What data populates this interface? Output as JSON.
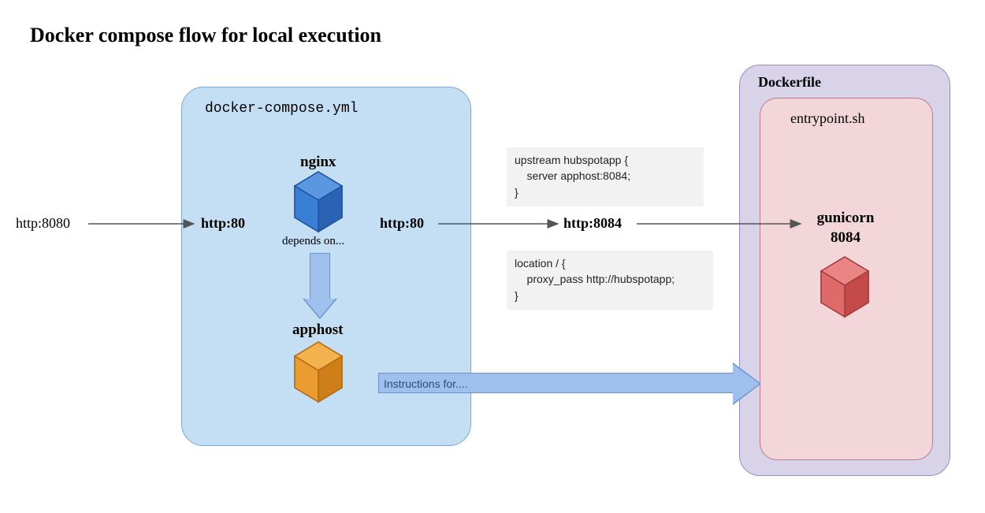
{
  "title": "Docker compose flow for local execution",
  "compose": {
    "filename": "docker-compose.yml",
    "service_nginx": "nginx",
    "depends_label": "depends on...",
    "service_apphost": "apphost"
  },
  "ports": {
    "external": "http:8080",
    "nginx_in": "http:80",
    "nginx_out": "http:80",
    "apphost_in": "http:8084"
  },
  "dockerfile": {
    "label": "Dockerfile",
    "entrypoint": "entrypoint.sh",
    "gunicorn": "gunicorn\n8084"
  },
  "nginx_conf": {
    "upstream": "upstream hubspotapp {\n    server apphost:8084;\n}",
    "location": "location / {\n    proxy_pass http://hubspotapp;\n}"
  },
  "instructions_label": "Instructions for....",
  "icons": {
    "nginx_cube": "cube-icon",
    "apphost_cube": "cube-icon",
    "gunicorn_cube": "cube-icon"
  }
}
